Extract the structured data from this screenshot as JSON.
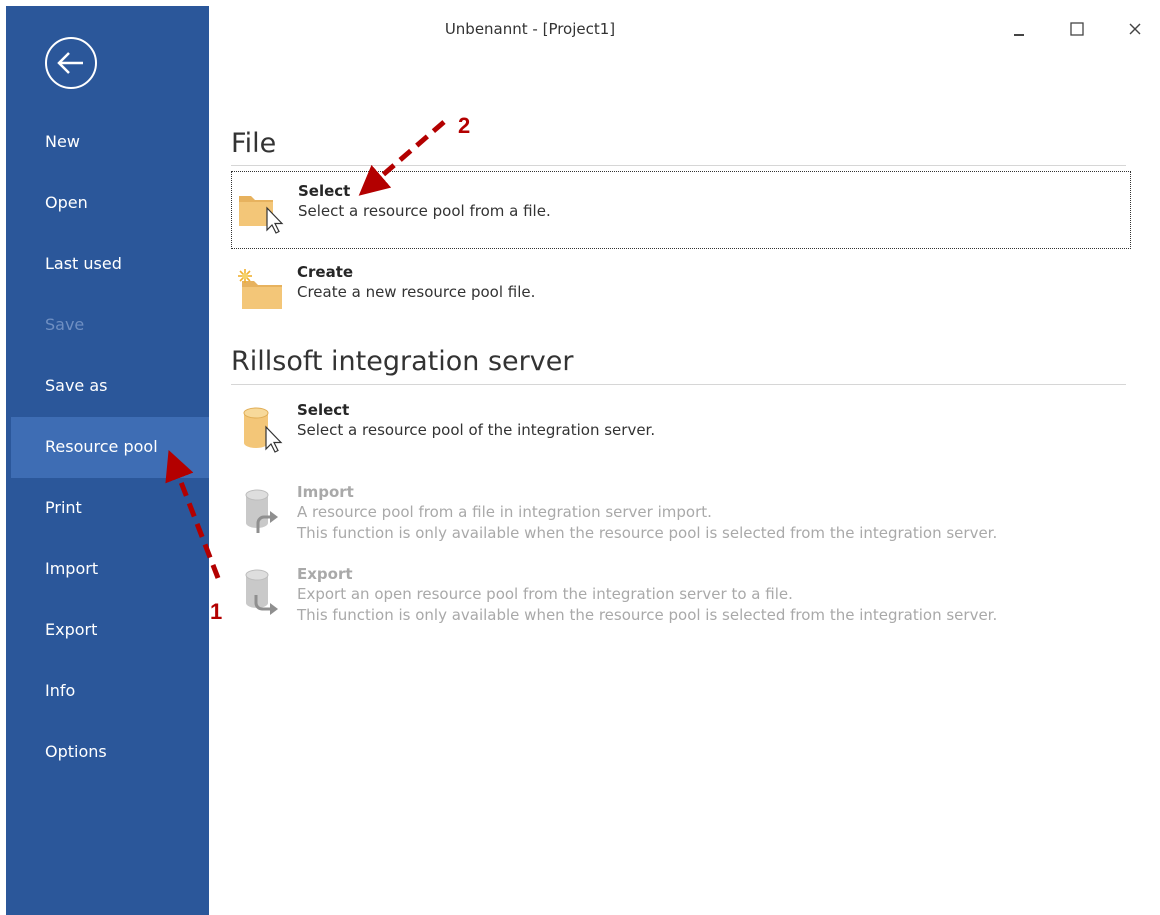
{
  "window": {
    "title": "Unbenannt - [Project1]",
    "controls": [
      "minimize-icon",
      "maximize-icon",
      "close-icon"
    ]
  },
  "sidebar": {
    "back_icon": "back-arrow-icon",
    "items": [
      {
        "label": "New",
        "state": "normal"
      },
      {
        "label": "Open",
        "state": "normal"
      },
      {
        "label": "Last used",
        "state": "normal"
      },
      {
        "label": "Save",
        "state": "disabled"
      },
      {
        "label": "Save as",
        "state": "normal"
      },
      {
        "label": "Resource pool",
        "state": "active"
      },
      {
        "label": "Print",
        "state": "normal"
      },
      {
        "label": "Import",
        "state": "normal"
      },
      {
        "label": "Export",
        "state": "normal"
      },
      {
        "label": "Info",
        "state": "normal"
      },
      {
        "label": "Options",
        "state": "normal"
      }
    ]
  },
  "file_section": {
    "heading": "File",
    "select": {
      "title": "Select",
      "desc": "Select a resource pool from a file.",
      "icon": "folder-cursor-icon"
    },
    "create": {
      "title": "Create",
      "desc": "Create a new resource pool file.",
      "icon": "new-folder-icon"
    }
  },
  "server_section": {
    "heading": "Rillsoft integration server",
    "select": {
      "title": "Select",
      "desc": "Select a resource pool of the integration server.",
      "icon": "database-cursor-icon"
    },
    "import": {
      "title": "Import",
      "desc1": "A resource pool from a file in integration server import.",
      "desc2": "This function is only available when the resource pool is selected from the integration server.",
      "icon": "database-import-icon"
    },
    "export": {
      "title": "Export",
      "desc1": "Export an open resource pool from the integration server to a file.",
      "desc2": "This function is only available when the resource pool is selected from the integration server.",
      "icon": "database-export-icon"
    }
  },
  "annotations": {
    "marker1": "1",
    "marker2": "2"
  },
  "colors": {
    "sidebar": "#2b579a",
    "active_item": "#3e6db4",
    "annotation": "#b30000",
    "folder": "#f3c678"
  }
}
